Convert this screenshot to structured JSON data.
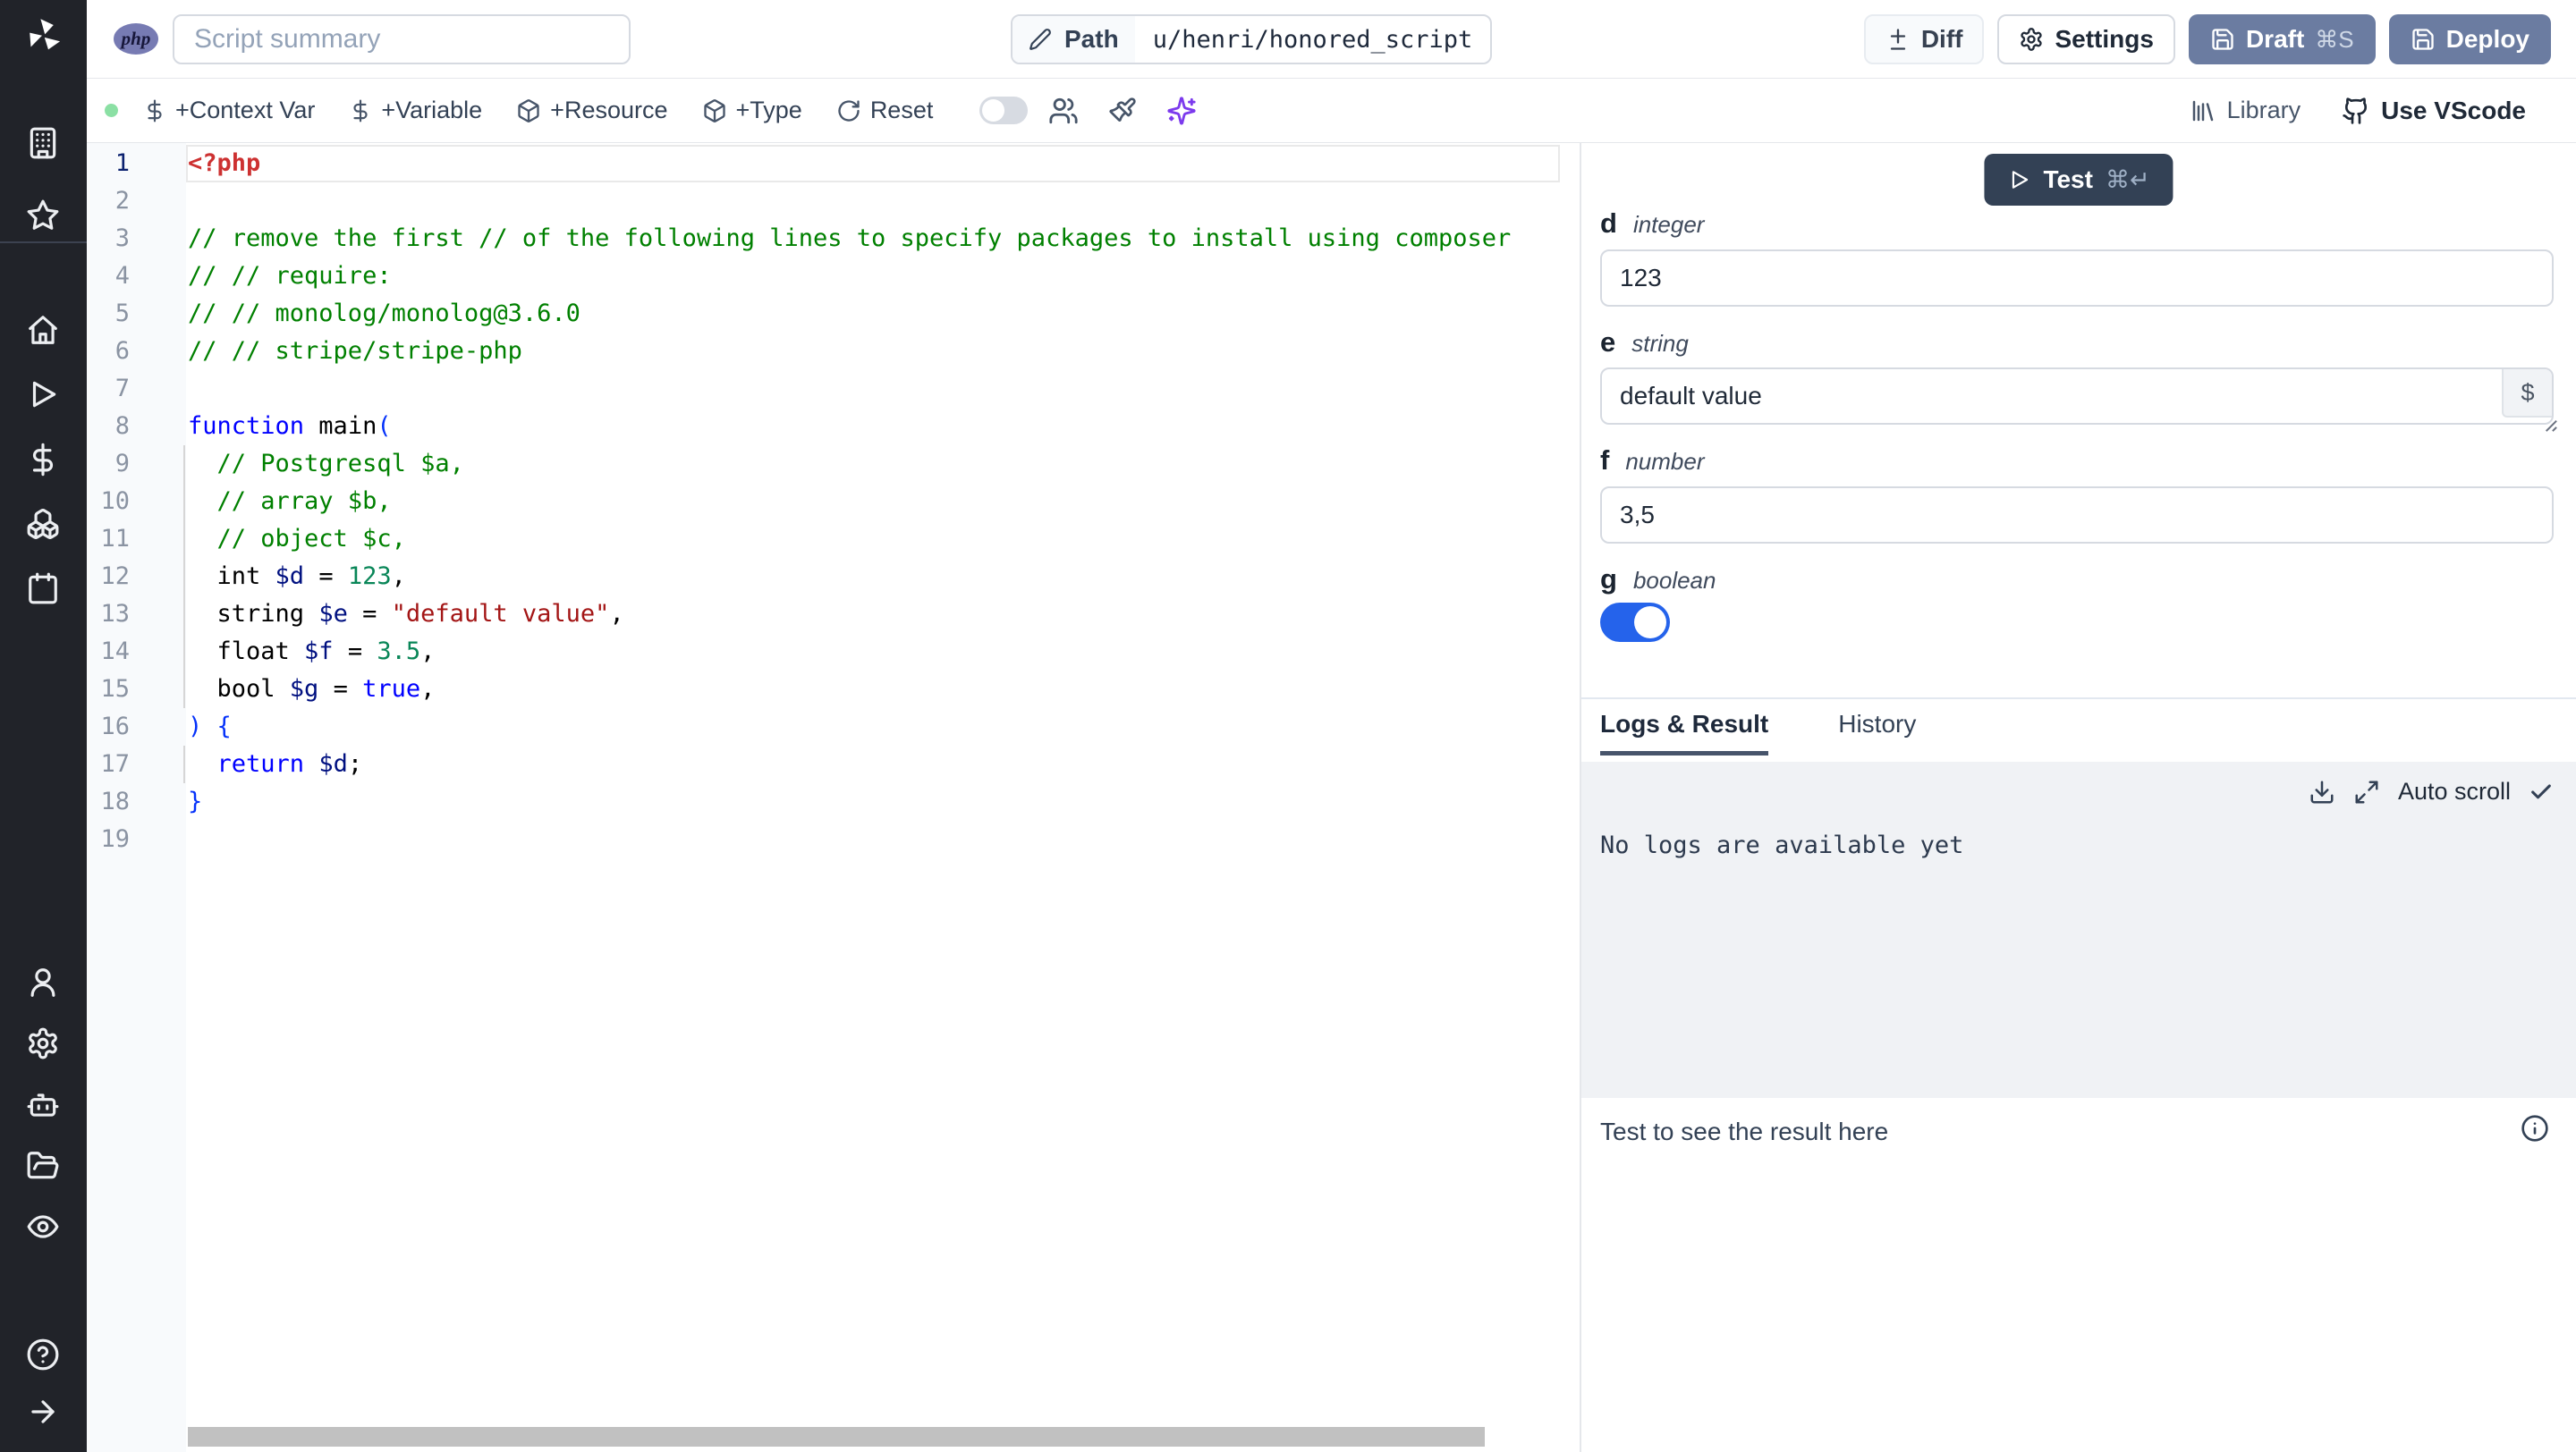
{
  "app": {
    "name": "windmill-script-editor",
    "language_badge": "php"
  },
  "topbar": {
    "summary_placeholder": "Script summary",
    "path_label": "Path",
    "path_value": "u/henri/honored_script",
    "diff_label": "Diff",
    "settings_label": "Settings",
    "draft_label": "Draft",
    "draft_shortcut": "⌘S",
    "deploy_label": "Deploy"
  },
  "toolbar": {
    "add_context_var": "+Context Var",
    "add_variable": "+Variable",
    "add_resource": "+Resource",
    "add_type": "+Type",
    "reset": "Reset",
    "library": "Library",
    "use_vscode": "Use VScode",
    "status_dot_color": "#8be0a4",
    "ai_icon_color": "#7c3aed"
  },
  "sidebar": {
    "icons": [
      "windmill-logo",
      "building",
      "star",
      "home",
      "play-runs",
      "dollar-variables",
      "boxes-resources",
      "calendar-schedules",
      "user",
      "gear-settings",
      "robot-workers",
      "folder-open",
      "eye-audit",
      "help-circle",
      "arrow-right-collapse"
    ]
  },
  "editor": {
    "active_line": 1,
    "syntax_colors": {
      "metatag": "#cd3131",
      "comment": "#008000",
      "keyword": "#0000ff",
      "plain": "#000000",
      "variable": "#001080",
      "number": "#098658",
      "string": "#a31515",
      "bracket": "#0431fa"
    },
    "lines": [
      {
        "n": 1,
        "tokens": [
          [
            "<?php",
            "meta"
          ]
        ]
      },
      {
        "n": 2,
        "tokens": []
      },
      {
        "n": 3,
        "tokens": [
          [
            "// remove the first // of the following lines to specify packages to install using composer",
            "com"
          ]
        ]
      },
      {
        "n": 4,
        "tokens": [
          [
            "// // require:",
            "com"
          ]
        ]
      },
      {
        "n": 5,
        "tokens": [
          [
            "// // monolog/monolog@3.6.0",
            "com"
          ]
        ]
      },
      {
        "n": 6,
        "tokens": [
          [
            "// // stripe/stripe-php",
            "com"
          ]
        ]
      },
      {
        "n": 7,
        "tokens": []
      },
      {
        "n": 8,
        "tokens": [
          [
            "function",
            "kw"
          ],
          [
            " main",
            "pl"
          ],
          [
            "(",
            "br"
          ]
        ]
      },
      {
        "n": 9,
        "tokens": [
          [
            "  // Postgresql $a,",
            "com"
          ]
        ]
      },
      {
        "n": 10,
        "tokens": [
          [
            "  // array $b,",
            "com"
          ]
        ]
      },
      {
        "n": 11,
        "tokens": [
          [
            "  // object $c,",
            "com"
          ]
        ]
      },
      {
        "n": 12,
        "tokens": [
          [
            "  int ",
            "pl"
          ],
          [
            "$d",
            "var"
          ],
          [
            " = ",
            "pl"
          ],
          [
            "123",
            "num"
          ],
          [
            ",",
            "pl"
          ]
        ]
      },
      {
        "n": 13,
        "tokens": [
          [
            "  string ",
            "pl"
          ],
          [
            "$e",
            "var"
          ],
          [
            " = ",
            "pl"
          ],
          [
            "\"default value\"",
            "str"
          ],
          [
            ",",
            "pl"
          ]
        ]
      },
      {
        "n": 14,
        "tokens": [
          [
            "  float ",
            "pl"
          ],
          [
            "$f",
            "var"
          ],
          [
            " = ",
            "pl"
          ],
          [
            "3.5",
            "num"
          ],
          [
            ",",
            "pl"
          ]
        ]
      },
      {
        "n": 15,
        "tokens": [
          [
            "  bool ",
            "pl"
          ],
          [
            "$g",
            "var"
          ],
          [
            " = ",
            "pl"
          ],
          [
            "true",
            "kw"
          ],
          [
            ",",
            "pl"
          ]
        ]
      },
      {
        "n": 16,
        "tokens": [
          [
            ")",
            "br"
          ],
          [
            " {",
            "br"
          ]
        ]
      },
      {
        "n": 17,
        "tokens": [
          [
            "  return",
            "kw"
          ],
          [
            " ",
            "pl"
          ],
          [
            "$d",
            "var"
          ],
          [
            ";",
            "pl"
          ]
        ]
      },
      {
        "n": 18,
        "tokens": [
          [
            "}",
            "br"
          ]
        ]
      },
      {
        "n": 19,
        "tokens": []
      }
    ]
  },
  "run_panel": {
    "test_label": "Test",
    "test_shortcut": "⌘↵",
    "test_button_color": "#334155",
    "fields": [
      {
        "name": "d",
        "type": "integer",
        "value": "123"
      },
      {
        "name": "e",
        "type": "string",
        "value": "default value",
        "addon": "$"
      },
      {
        "name": "f",
        "type": "number",
        "value": "3,5"
      },
      {
        "name": "g",
        "type": "boolean",
        "value": "true",
        "toggle_color": "#2563eb"
      }
    ],
    "tabs": [
      "Logs & Result",
      "History"
    ],
    "active_tab": "Logs & Result",
    "autoscroll_label": "Auto scroll",
    "logs_empty": "No logs are available yet",
    "result_empty": "Test to see the result here"
  }
}
